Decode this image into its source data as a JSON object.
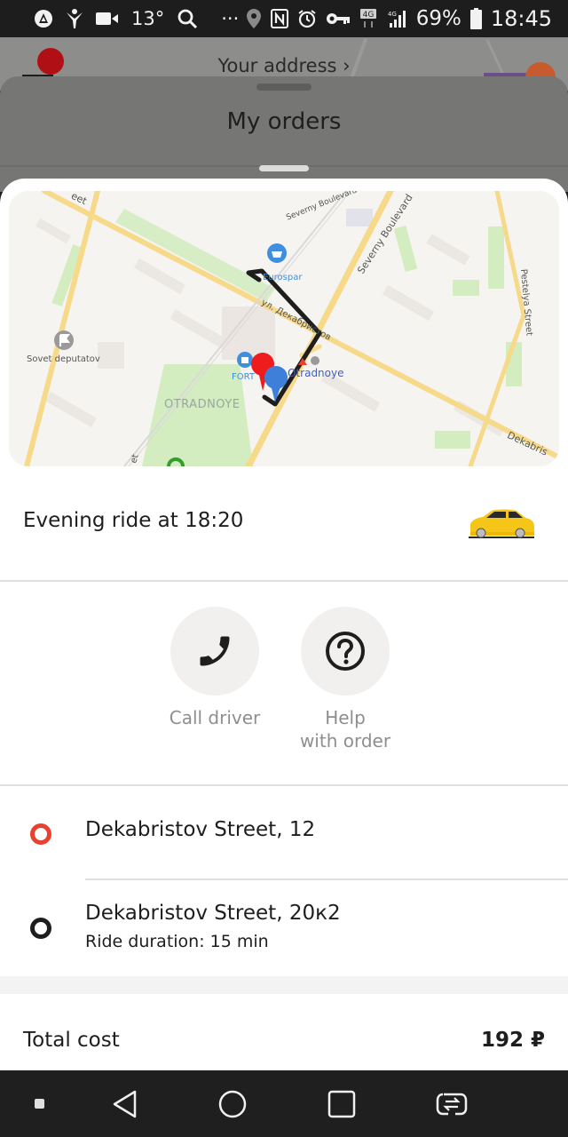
{
  "status_bar": {
    "temperature": "13°",
    "overflow": "···",
    "battery": "69%",
    "time": "18:45",
    "network": "4G",
    "icons_left": [
      "vpn-icon",
      "activity-icon",
      "video-icon",
      "temperature",
      "search-icon",
      "more-icon"
    ],
    "icons_right": [
      "location-icon",
      "nfc-icon",
      "alarm-icon",
      "key-icon",
      "network-4g-icon",
      "signal-icon",
      "battery-icon"
    ]
  },
  "background": {
    "address_link": "Your address ›"
  },
  "orders_sheet": {
    "title": "My orders"
  },
  "map": {
    "labels": {
      "severny_boulevard_top": "Severny Boulevard",
      "severny_boulevard": "Severny Boulevard",
      "pestelya": "Pestelya Street",
      "eurospar": "Eurospar",
      "dekabristov_ru": "ул. Декабристов",
      "sovet": "Sovet deputatov",
      "fort": "FORT",
      "otradnoye_metro": "Otradnoye",
      "district": "OTRADNOYE",
      "dekabris": "Dekabris",
      "street_top_left": "eet",
      "street_bottom": "et"
    },
    "colors": {
      "pickup_pin": "#ee1c1c",
      "dropoff_pin": "#3d7fd9",
      "route": "#1e1e1e",
      "road": "#f7d98a",
      "park": "#d3ecc0"
    }
  },
  "ride": {
    "title": "Evening ride at 18:20",
    "vehicle_icon": "taxi-car-icon"
  },
  "actions": [
    {
      "label": "Call driver",
      "icon": "phone-icon"
    },
    {
      "label": "Help\nwith order",
      "label_line1": "Help",
      "label_line2": "with order",
      "icon": "help-icon"
    }
  ],
  "route": {
    "pickup": {
      "address": "Dekabristov Street, 12",
      "color": "#e8412f"
    },
    "dropoff": {
      "address": "Dekabristov Street, 20к2",
      "duration": "Ride duration: 15 min",
      "color": "#1e1e1e"
    }
  },
  "total": {
    "label": "Total cost",
    "value": "192 ₽"
  },
  "nav_bar": {
    "buttons": [
      "dot-indicator",
      "back-button",
      "home-button",
      "recents-button",
      "switch-app-button"
    ]
  }
}
